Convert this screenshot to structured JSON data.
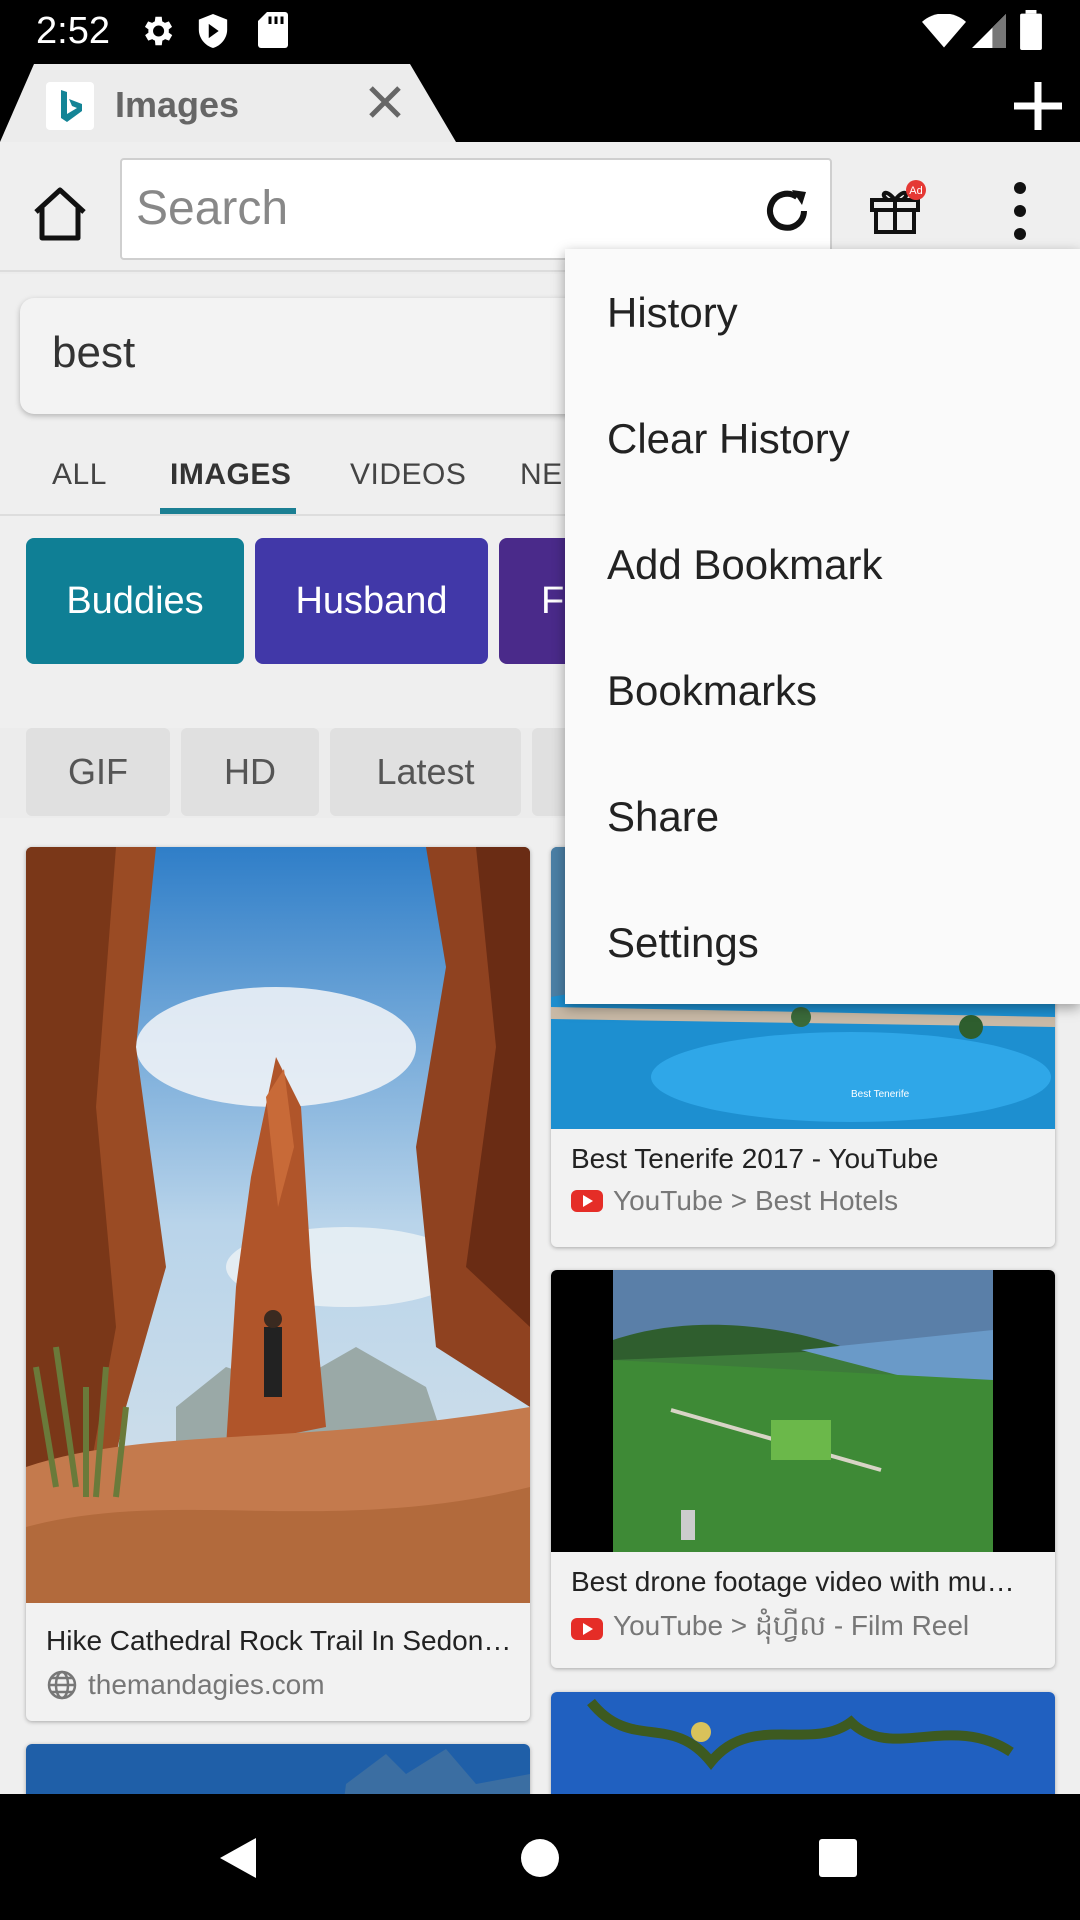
{
  "status_bar": {
    "time": "2:52"
  },
  "tab": {
    "title": "Images"
  },
  "toolbar": {
    "search_placeholder": "Search"
  },
  "query": "best",
  "nav_tabs": [
    "ALL",
    "IMAGES",
    "VIDEOS",
    "NE"
  ],
  "chips": [
    {
      "label": "Buddies",
      "color": "#0f7f95"
    },
    {
      "label": "Husband",
      "color": "#4138a8"
    },
    {
      "label": "Fr",
      "color": "#4a2a8a"
    }
  ],
  "filters": [
    "GIF",
    "HD",
    "Latest"
  ],
  "results": [
    {
      "title": "Hike Cathedral Rock Trail In Sedon…",
      "source": "themandagies.com"
    },
    {
      "title": "Best Tenerife 2017 - YouTube",
      "source": "YouTube > Best Hotels"
    },
    {
      "title": "Best drone footage video with mu…",
      "source": "YouTube > ដុំហ្វីល - Film Reel"
    }
  ],
  "menu": {
    "items": [
      "History",
      "Clear History",
      "Add Bookmark",
      "Bookmarks",
      "Share",
      "Settings"
    ]
  },
  "colors": {
    "accent": "#1b7f93",
    "badge": "#e53935"
  }
}
